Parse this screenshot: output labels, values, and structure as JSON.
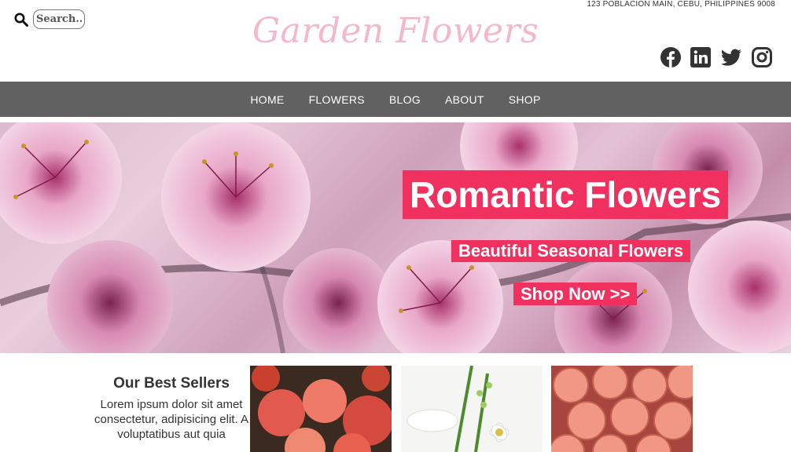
{
  "search": {
    "placeholder": "Search..."
  },
  "brand": "Garden Flowers",
  "address": "123 POBLACION MAIN, CEBU, PHILIPPINES 9008",
  "socials": [
    "facebook-icon",
    "linkedin-icon",
    "twitter-icon",
    "instagram-icon"
  ],
  "nav": [
    "HOME",
    "FLOWERS",
    "BLOG",
    "ABOUT",
    "SHOP"
  ],
  "hero": {
    "title": "Romantic Flowers",
    "subtitle": "Beautiful Seasonal Flowers",
    "cta": "Shop Now >>",
    "accent": "#f0305e"
  },
  "best": {
    "title": "Our Best Sellers",
    "text": "Lorem ipsum dolor sit amet consectetur, adipisicing elit. A voluptatibus aut quia"
  },
  "colors": {
    "nav_bg": "#616161",
    "brand": "#f4b8c8"
  }
}
